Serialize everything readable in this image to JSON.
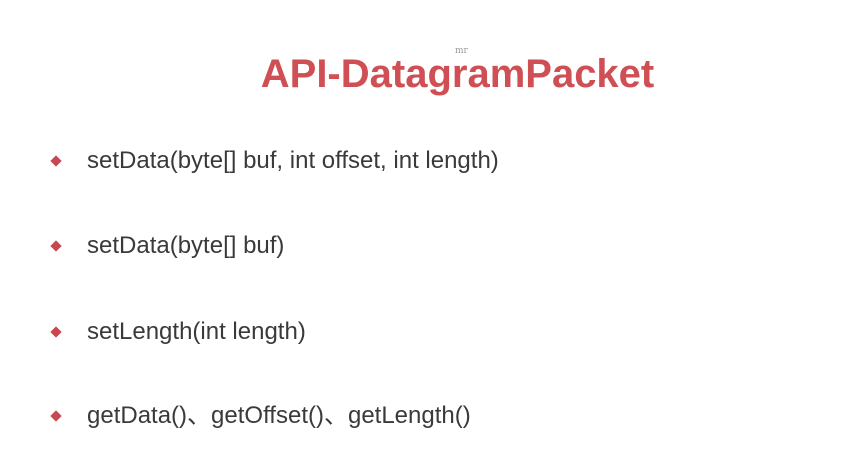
{
  "watermark": "mr",
  "title": "API-DatagramPacket",
  "accent_color": "#cf4f55",
  "bullet_icon": "diamond-bullet-icon",
  "items": [
    {
      "text": "setData(byte[] buf, int offset, int length)"
    },
    {
      "text": "setData(byte[] buf)"
    },
    {
      "text": "setLength(int length)"
    },
    {
      "text": "getData()、getOffset()、getLength()"
    }
  ]
}
